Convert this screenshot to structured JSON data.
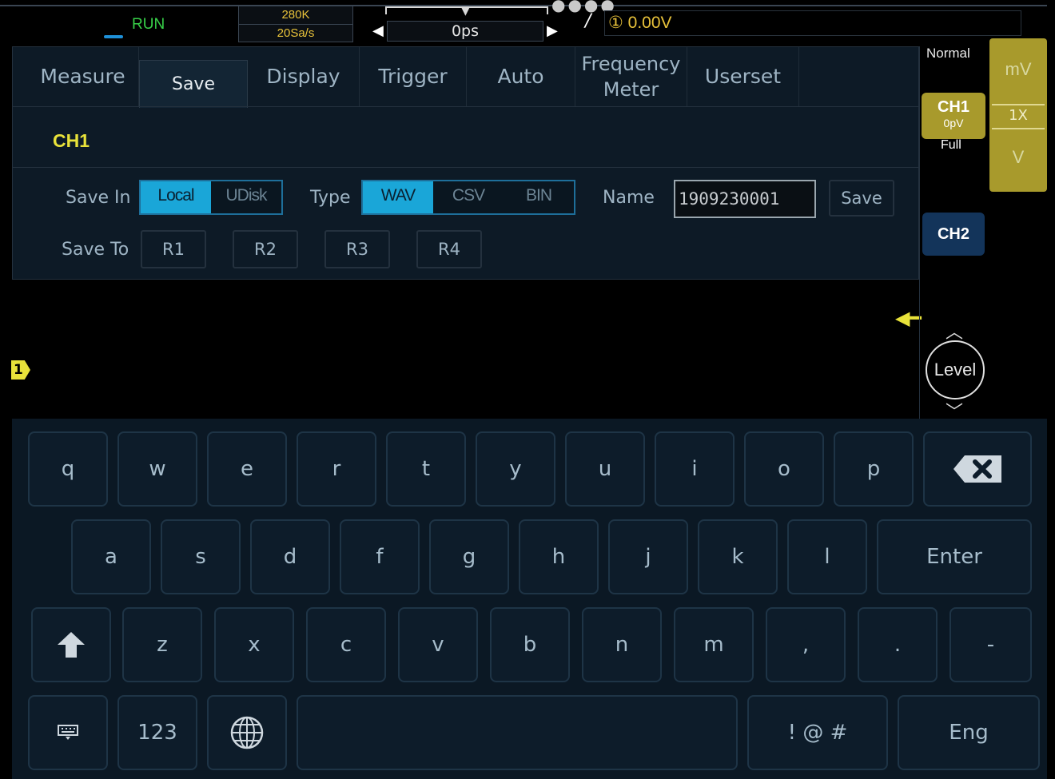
{
  "status": {
    "run_state": "RUN",
    "memory_depth": "280K",
    "sample_rate": "20Sa/s",
    "time_offset": "0ps",
    "trigger_channel_symbol": "①",
    "trigger_level": "0.00V",
    "trigger_mode": "Normal"
  },
  "tabs": [
    {
      "label": "Measure",
      "active": false
    },
    {
      "label": "Save",
      "active": true
    },
    {
      "label": "Display",
      "active": false
    },
    {
      "label": "Trigger",
      "active": false
    },
    {
      "label": "Auto",
      "active": false
    },
    {
      "label": "Frequency Meter",
      "active": false
    },
    {
      "label": "Userset",
      "active": false
    }
  ],
  "save": {
    "channel": "CH1",
    "save_in_label": "Save In",
    "save_in_options": [
      "Local",
      "UDisk"
    ],
    "save_in_selected": "Local",
    "type_label": "Type",
    "type_options": [
      "WAV",
      "CSV",
      "BIN"
    ],
    "type_selected": "WAV",
    "name_label": "Name",
    "name_value": "1909230001",
    "save_button": "Save",
    "save_to_label": "Save To",
    "save_to_options": [
      "R1",
      "R2",
      "R3",
      "R4"
    ]
  },
  "waveform": {
    "channel_marker": "1"
  },
  "channels": {
    "ch1_label": "CH1",
    "ch1_offset": "0pV",
    "ch1_bandwidth": "Full",
    "ch2_label": "CH2",
    "scale_unit_top": "mV",
    "scale_probe": "1X",
    "scale_unit_bottom": "V",
    "level_label": "Level"
  },
  "keyboard": {
    "row1": [
      "q",
      "w",
      "e",
      "r",
      "t",
      "y",
      "u",
      "i",
      "o",
      "p"
    ],
    "row2": [
      "a",
      "s",
      "d",
      "f",
      "g",
      "h",
      "j",
      "k",
      "l"
    ],
    "row3": [
      "z",
      "x",
      "c",
      "v",
      "b",
      "n",
      "m",
      ",",
      ".",
      "-"
    ],
    "enter": "Enter",
    "numbers": "123",
    "symbols": "! @ #",
    "language": "Eng"
  },
  "colors": {
    "accent_blue": "#1aa6d8",
    "channel1_yellow": "#e8e23a",
    "run_green": "#38d048",
    "ch1_badge": "#a89a2c",
    "ch2_badge": "#13345a"
  }
}
